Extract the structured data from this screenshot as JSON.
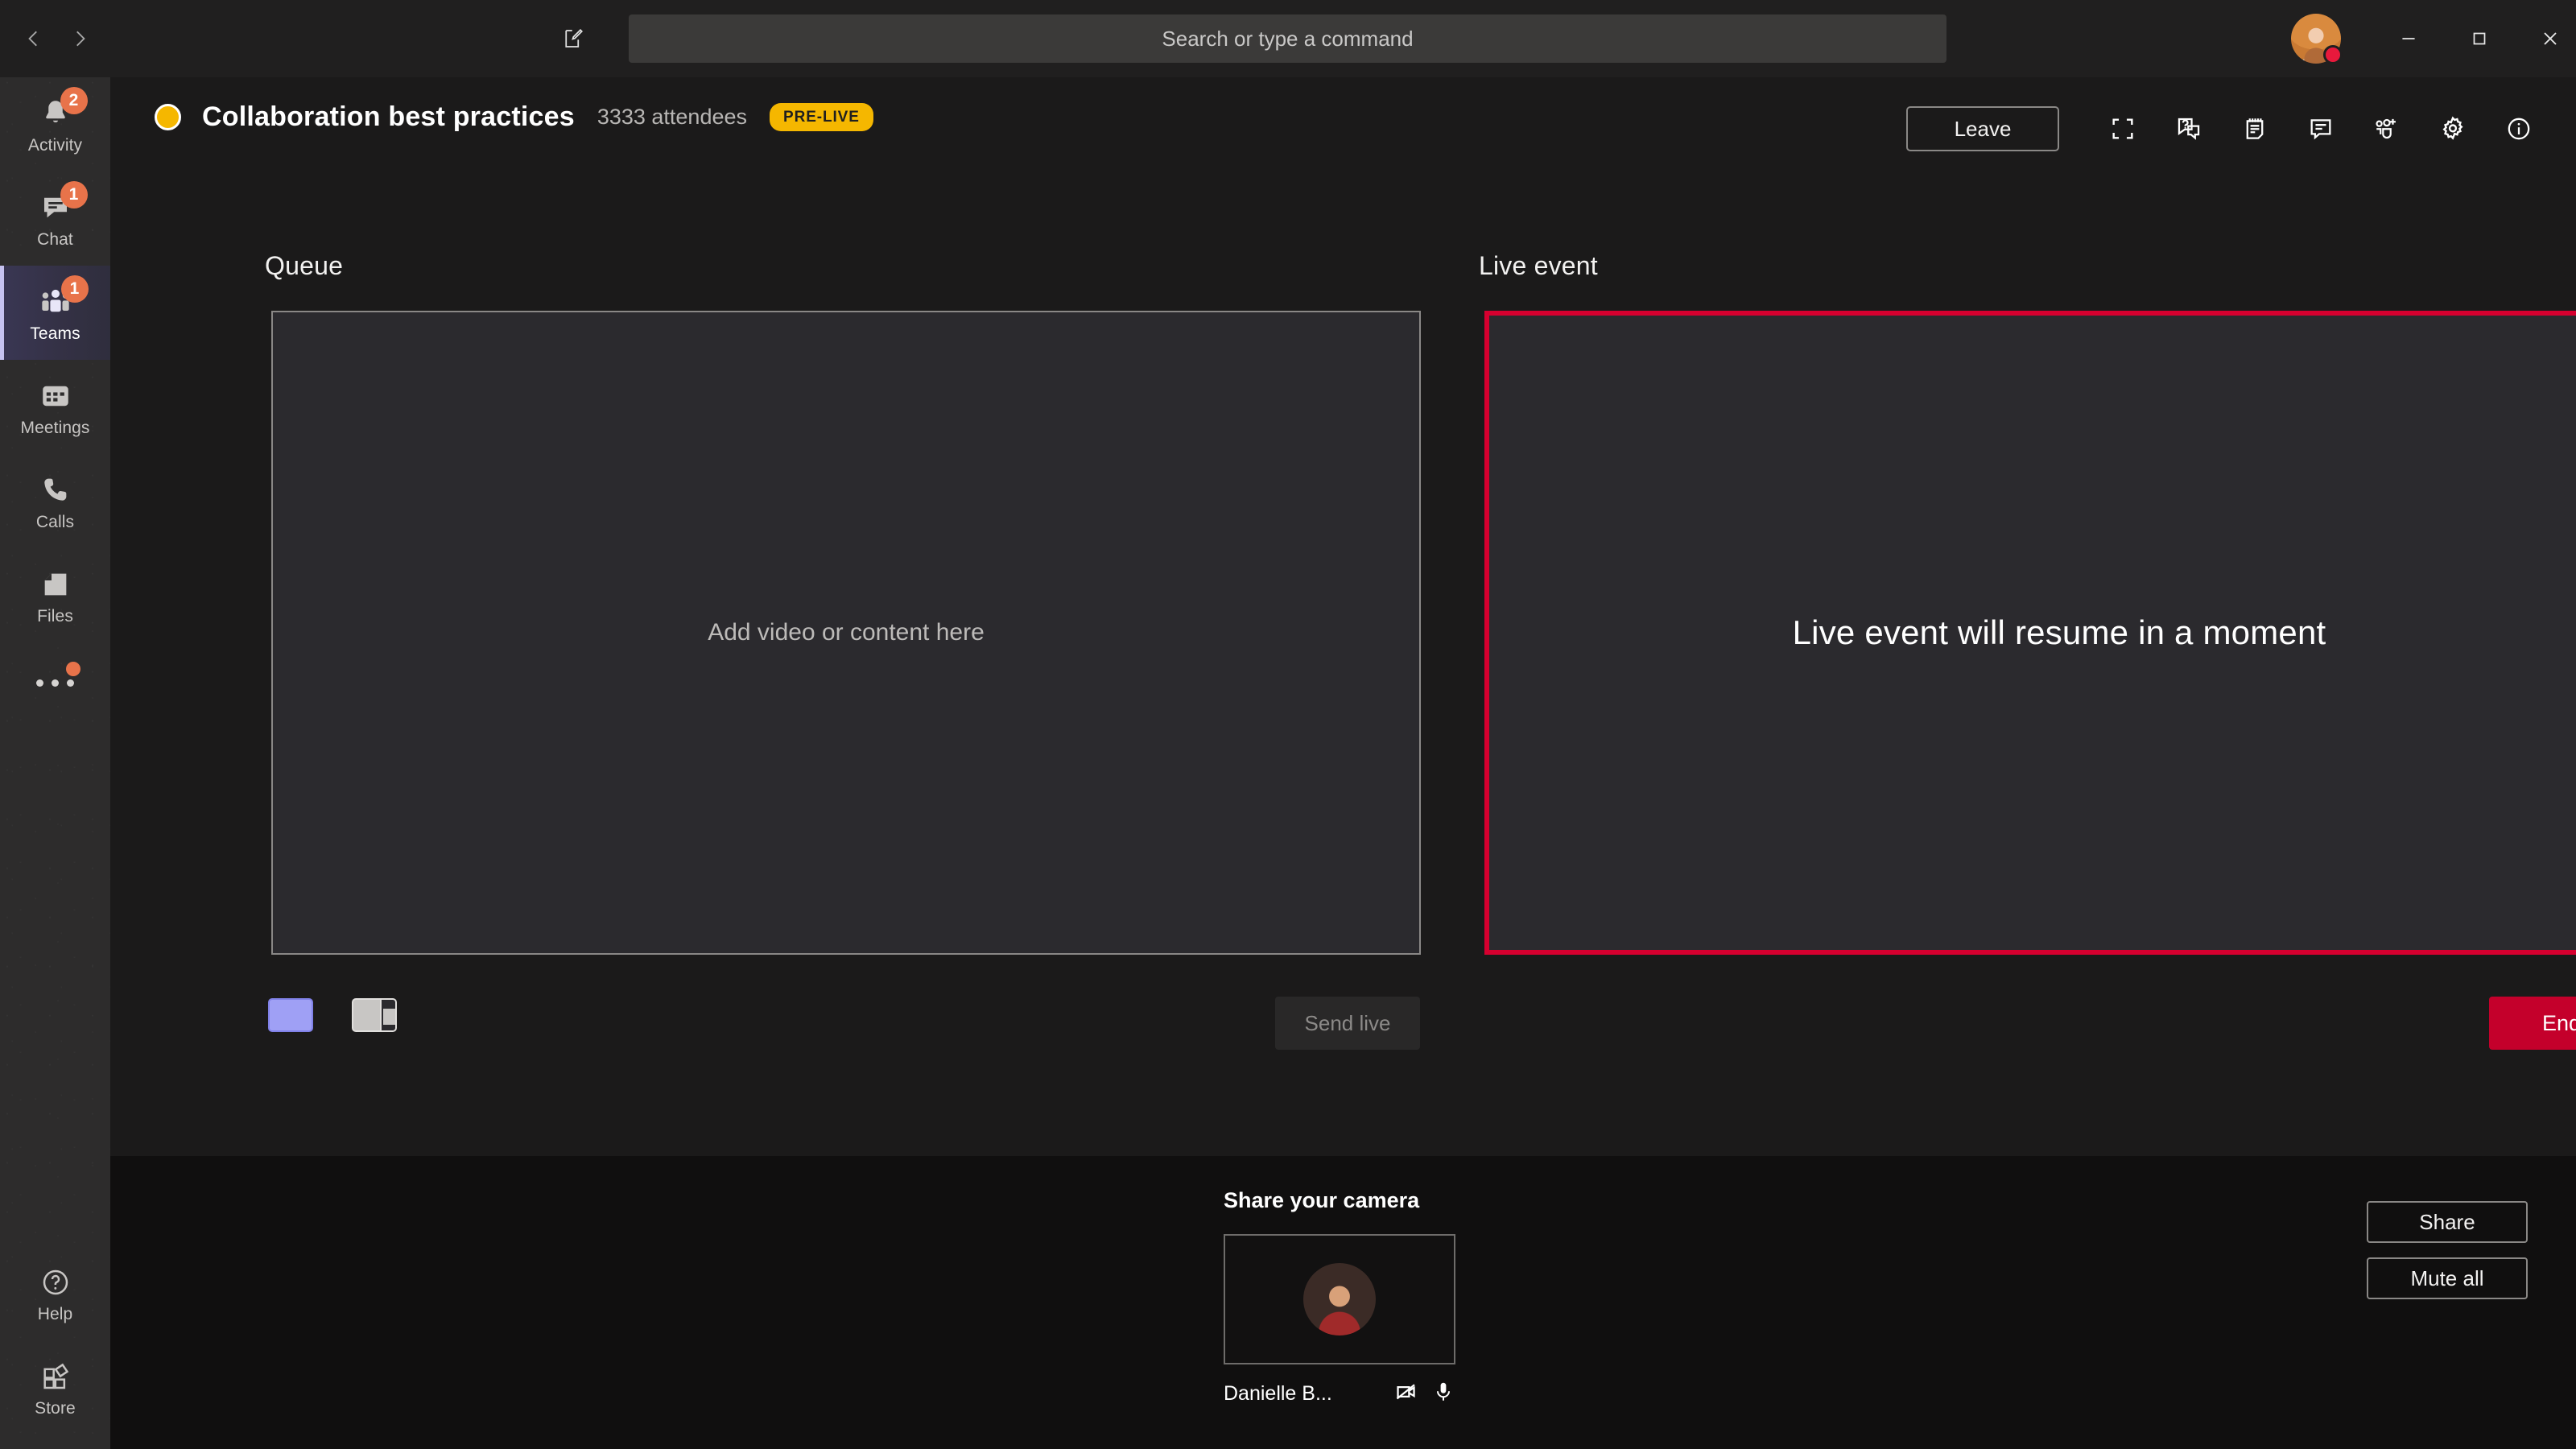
{
  "titlebar": {
    "back_icon": "chevron-left-icon",
    "forward_icon": "chevron-right-icon",
    "compose_icon": "compose-icon",
    "search": {
      "placeholder": "Search or type a command",
      "value": ""
    },
    "avatar_name": "user-avatar",
    "presence": "busy",
    "presence_color": "#e8193c",
    "minimize_label": "Minimize",
    "maximize_label": "Maximize",
    "close_label": "Close"
  },
  "rail": {
    "items": [
      {
        "label": "Activity",
        "icon": "bell-icon",
        "badge": "2",
        "active": false
      },
      {
        "label": "Chat",
        "icon": "chat-icon",
        "badge": "1",
        "active": false
      },
      {
        "label": "Teams",
        "icon": "teams-icon",
        "badge": "1",
        "active": true
      },
      {
        "label": "Meetings",
        "icon": "calendar-icon",
        "badge": "",
        "active": false
      },
      {
        "label": "Calls",
        "icon": "phone-icon",
        "badge": "",
        "active": false
      },
      {
        "label": "Files",
        "icon": "files-icon",
        "badge": "",
        "active": false
      }
    ],
    "more_icon": "more-ellipsis-icon",
    "bottom_items": [
      {
        "label": "Help",
        "icon": "help-icon"
      },
      {
        "label": "Store",
        "icon": "store-icon"
      }
    ],
    "badge_color": "#e8734a",
    "active_accent": "#c6c2f0"
  },
  "event": {
    "status_dot_color": "#f5b700",
    "title": "Collaboration best practices",
    "attendees": "3333 attendees",
    "state_badge": "PRE-LIVE",
    "state_badge_color": "#f5b700"
  },
  "toolbar": {
    "leave_label": "Leave",
    "icons": [
      {
        "name": "fullscreen-icon"
      },
      {
        "name": "qna-icon"
      },
      {
        "name": "notes-icon"
      },
      {
        "name": "meeting-chat-icon"
      },
      {
        "name": "add-participants-icon"
      },
      {
        "name": "settings-gear-icon"
      },
      {
        "name": "info-icon"
      }
    ]
  },
  "queue": {
    "label": "Queue",
    "placeholder": "Add video or content here",
    "layout_options": [
      {
        "name": "layout-single",
        "selected": true,
        "color": "#9fa0f5"
      },
      {
        "name": "layout-split",
        "selected": false,
        "color": "#c8c6c4"
      }
    ],
    "send_live_label": "Send live",
    "send_live_disabled": true
  },
  "live": {
    "label": "Live event",
    "message": "Live event will resume in a moment",
    "border_color": "#d6002f",
    "end_label": "End",
    "end_color": "#c4002b"
  },
  "bottom": {
    "share_camera_title": "Share your camera",
    "camera_name": "Danielle B...",
    "camera_off_icon": "camera-off-icon",
    "mic_icon": "microphone-icon",
    "share_label": "Share",
    "mute_all_label": "Mute all"
  }
}
